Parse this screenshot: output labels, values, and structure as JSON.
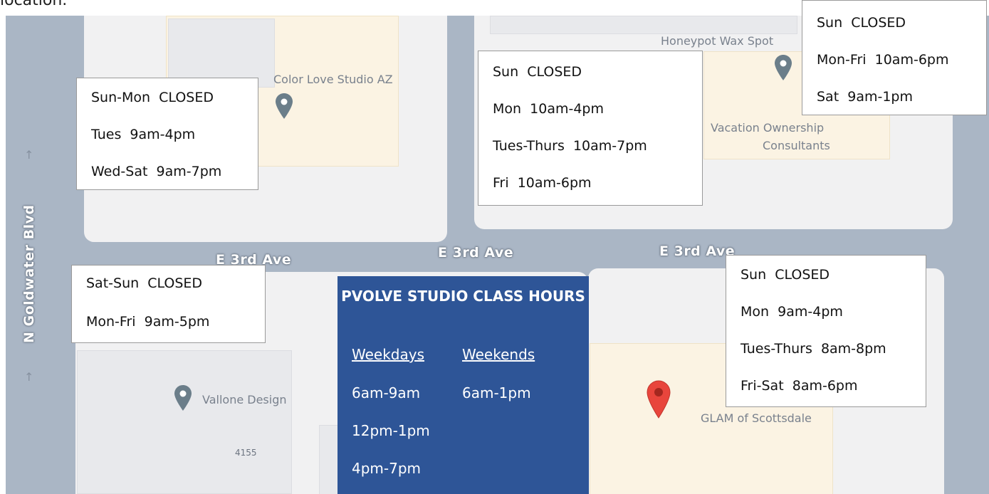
{
  "cut_text": "location.",
  "map": {
    "roads": {
      "e3rd_ave_labels": [
        "E 3rd Ave",
        "E 3rd Ave",
        "E 3rd Ave"
      ],
      "goldwater_label": "N Goldwater Blvd"
    },
    "places": {
      "color_love": "Color Love Studio AZ",
      "honeypot": "Honeypot Wax Spot",
      "vacation_line1": "Vacation Ownership",
      "vacation_line2": "Consultants",
      "vallone": "Vallone Design",
      "glam": "GLAM of Scottsdale",
      "building_number": "4155"
    },
    "colors": {
      "road": "#aab6c5",
      "block": "#f1f1f2",
      "building": "#e8e9ec",
      "commercial": "#fbf3e3",
      "pin_gray": "#6b7e8a",
      "pin_red": "#e8453c",
      "pvolve_box": "#2e5597"
    }
  },
  "hours_boxes": {
    "color_love": [
      "Sun-Mon  CLOSED",
      "Tues  9am-4pm",
      "Wed-Sat  9am-7pm"
    ],
    "middle_top": [
      "Sun  CLOSED",
      "Mon  10am-4pm",
      "Tues-Thurs  10am-7pm",
      "Fri  10am-6pm"
    ],
    "honeypot": [
      "Sun  CLOSED",
      "Mon-Fri  10am-6pm",
      "Sat  9am-1pm"
    ],
    "vallone": [
      "Sat-Sun  CLOSED",
      "Mon-Fri  9am-5pm"
    ],
    "glam": [
      "Sun  CLOSED",
      "Mon  9am-4pm",
      "Tues-Thurs  8am-8pm",
      "Fri-Sat  8am-6pm"
    ]
  },
  "pvolve": {
    "title": "PVOLVE STUDIO CLASS HOURS",
    "weekdays_header": "Weekdays",
    "weekends_header": "Weekends",
    "weekdays": [
      "6am-9am",
      "12pm-1pm",
      "4pm-7pm"
    ],
    "weekends": [
      "6am-1pm"
    ]
  }
}
